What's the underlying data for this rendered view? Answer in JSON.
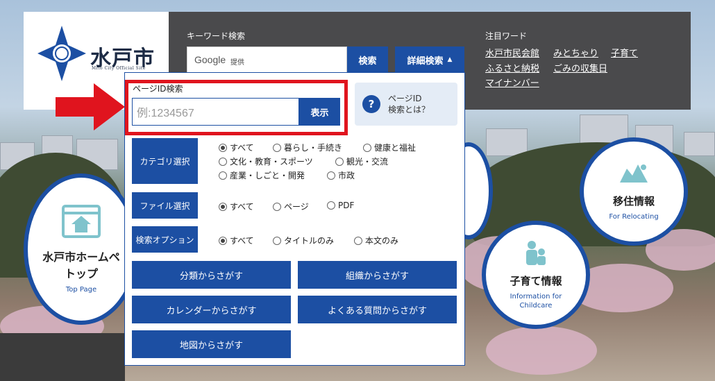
{
  "logo": {
    "name": "水戸市",
    "sub": "Mito City Official Site"
  },
  "search": {
    "keyword_label": "キーワード検索",
    "google_text": "Google",
    "google_provided": "提供",
    "search_button": "検索",
    "detail_button": "詳細検索",
    "detail_arrow": "▲"
  },
  "attention": {
    "label": "注目ワード",
    "links": [
      "水戸市民会館",
      "みとちゃり",
      "子育て",
      "ふるさと納税",
      "ごみの収集日",
      "マイナンバー"
    ]
  },
  "circles": {
    "top": {
      "title1": "水戸市ホームペ",
      "title2": "トップ",
      "en": "Top Page"
    },
    "childcare": {
      "title": "子育て情報",
      "en1": "Information for",
      "en2": "Childcare"
    },
    "relocating": {
      "title": "移住情報",
      "en": "For Relocating"
    }
  },
  "panel": {
    "page_id": {
      "label": "ページID検索",
      "placeholder": "例:1234567",
      "button": "表示"
    },
    "help": {
      "line1": "ページID",
      "line2": "検索とは？",
      "icon": "?"
    },
    "category": {
      "label": "カテゴリ選択",
      "options": [
        "すべて",
        "暮らし・手続き",
        "健康と福祉",
        "文化・教育・スポーツ",
        "観光・交流",
        "産業・しごと・開発",
        "市政"
      ],
      "selected": "すべて"
    },
    "file": {
      "label": "ファイル選択",
      "options": [
        "すべて",
        "ページ",
        "PDF"
      ],
      "selected": "すべて"
    },
    "search_option": {
      "label": "検索オプション",
      "options": [
        "すべて",
        "タイトルのみ",
        "本文のみ"
      ],
      "selected": "すべて"
    },
    "buttons": [
      "分類からさがす",
      "組織からさがす",
      "カレンダーからさがす",
      "よくある質問からさがす",
      "地図からさがす"
    ]
  },
  "colors": {
    "brand_blue": "#1c4fa3",
    "header_dark": "#4a4a4c",
    "highlight_red": "#e0141e"
  }
}
